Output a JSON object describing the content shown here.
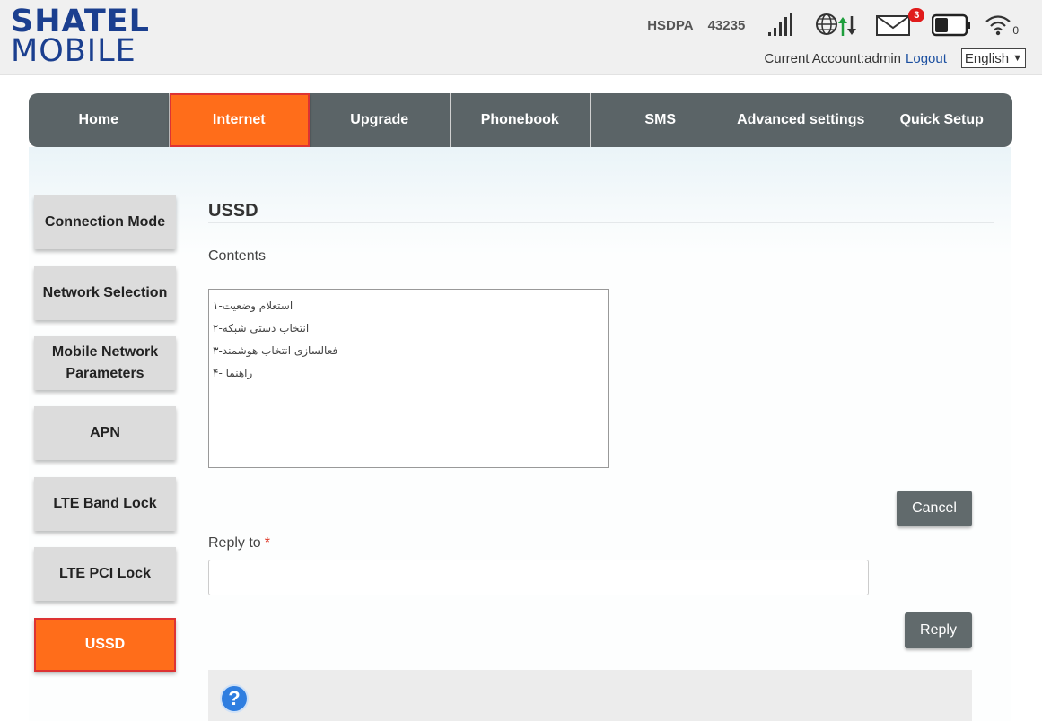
{
  "brand": {
    "line1": "SHATEL",
    "line2": "MOBILE",
    "color": "#1b3f8f"
  },
  "status": {
    "network_type": "HSDPA",
    "network_code": "43235",
    "signal_icon": "signal-bars-icon",
    "internet_icon": "globe-data-icon",
    "sms_icon": "envelope-icon",
    "sms_count": "3",
    "battery_icon": "battery-icon",
    "wifi_icon": "wifi-icon",
    "wifi_clients": "0"
  },
  "account": {
    "label": "Current Account:admin",
    "logout": "Logout",
    "language": "English"
  },
  "nav": {
    "items": [
      {
        "label": "Home"
      },
      {
        "label": "Internet",
        "active": true
      },
      {
        "label": "Upgrade"
      },
      {
        "label": "Phonebook"
      },
      {
        "label": "SMS"
      },
      {
        "label": "Advanced settings"
      },
      {
        "label": "Quick Setup"
      }
    ]
  },
  "sidebar": {
    "items": [
      {
        "label": "Connection Mode"
      },
      {
        "label": "Network Selection"
      },
      {
        "label": "Mobile Network Parameters"
      },
      {
        "label": "APN"
      },
      {
        "label": "LTE Band Lock"
      },
      {
        "label": "LTE PCI Lock"
      },
      {
        "label": "USSD",
        "active": true
      }
    ]
  },
  "main": {
    "title": "USSD",
    "contents_label": "Contents",
    "contents_lines": [
      "استعلام وضعیت-۱",
      "انتخاب دستی شبکه-۲",
      "فعالسازی انتخاب هوشمند-۳",
      "راهنما -۴"
    ],
    "cancel_label": "Cancel",
    "reply_to_label": "Reply to",
    "required_mark": "*",
    "reply_value": "",
    "reply_label": "Reply",
    "help_glyph": "?"
  },
  "colors": {
    "nav_bg": "#5b6467",
    "active": "#ff6d1a",
    "button": "#616a6c",
    "link": "#1b4fa0",
    "badge": "#e01b1b"
  }
}
